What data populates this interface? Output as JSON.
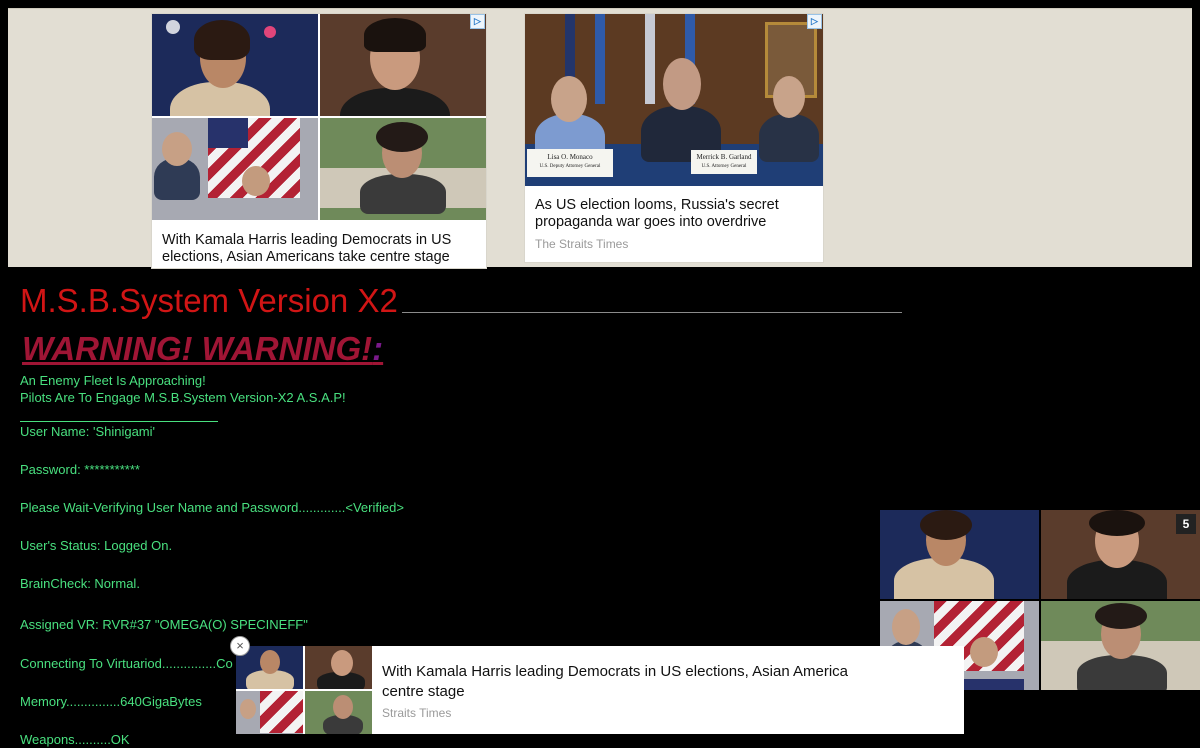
{
  "ads": {
    "card1": {
      "headline": "With Kamala Harris leading Democrats in US elections, Asian Americans take centre stage",
      "adchoice_icon": "adchoices-triangle-icon"
    },
    "card2": {
      "headline": "As US election looms, Russia's secret propaganda war goes into overdrive",
      "source": "The Straits Times",
      "adchoice_icon": "adchoices-triangle-icon"
    },
    "photo_captions": {
      "nameplate1": "Lisa O. Monaco",
      "nameplate1_sub": "U.S. Deputy Attorney General",
      "nameplate2": "Merrick B. Garland",
      "nameplate2_sub": "U.S. Attorney General"
    },
    "sticky": {
      "counter": "5"
    },
    "bottom": {
      "headline": "With Kamala Harris leading Democrats in US elections, Asian America centre stage",
      "source": "Straits Times",
      "close": "×"
    }
  },
  "terminal": {
    "title": "M.S.B.System Version X2",
    "warning": "WARNING! WARNING!",
    "warning_colon": ":",
    "lines": {
      "l1": "An Enemy Fleet Is Approaching!",
      "l2": "Pilots Are To Engage M.S.B.System Version-X2 A.S.A.P!",
      "username": "User Name: 'Shinigami'",
      "password": "Password: ***********",
      "verify": "Please Wait-Verifying User Name and Password.............<Verified>",
      "status": "User's Status: Logged On.",
      "brain": "BrainCheck: Normal.",
      "vr": "Assigned VR: RVR#37 \"OMEGA(Ο) SPECINEFF\"",
      "connect": "Connecting To Virtuariod...............Co",
      "memory": "Memory...............640GigaBytes",
      "weapons": "Weapons..........OK"
    }
  },
  "colors": {
    "terminal_green": "#49e07f",
    "title_red": "#d11515",
    "warning_crimson": "#a01535",
    "ad_banner_bg": "#e2ded3"
  }
}
